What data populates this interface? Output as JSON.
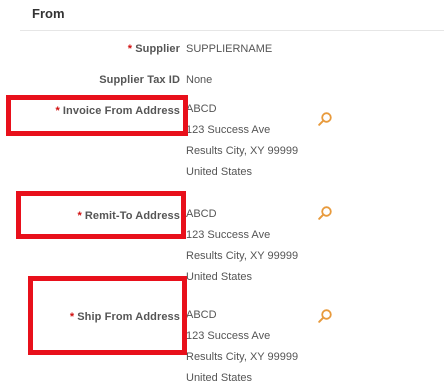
{
  "section": {
    "title": "From"
  },
  "fields": {
    "supplier": {
      "required_marker": "*",
      "label": "Supplier",
      "value": "SUPPLIERNAME"
    },
    "supplier_tax_id": {
      "label": "Supplier Tax ID",
      "value": "None"
    },
    "invoice_from_address": {
      "required_marker": "*",
      "label": "Invoice From Address",
      "lines": [
        "ABCD",
        "123 Success Ave",
        "Results City, XY 99999",
        "United States"
      ]
    },
    "remit_to_address": {
      "required_marker": "*",
      "label": "Remit-To Address",
      "lines": [
        "ABCD",
        "123 Success Ave",
        "Results City, XY 99999",
        "United States"
      ]
    },
    "ship_from_address": {
      "required_marker": "*",
      "label": "Ship From Address",
      "lines": [
        "ABCD",
        "123 Success Ave",
        "Results City, XY 99999",
        "United States"
      ]
    }
  },
  "colors": {
    "required_marker": "#d10f0f",
    "highlight_box": "#e8101b",
    "search_icon": "#e89a3c"
  },
  "icons": {
    "search": "search-icon"
  }
}
